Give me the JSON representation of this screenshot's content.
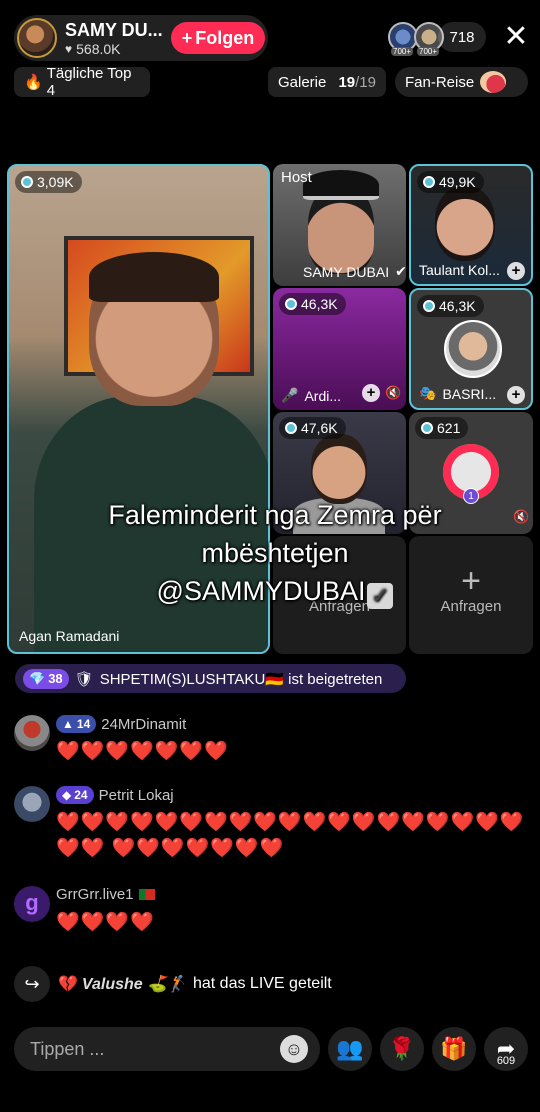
{
  "header": {
    "host_name": "SAMY DU...",
    "likes": "568.0K",
    "follow_label": "Folgen",
    "viewer_count": "718",
    "avatar_badge_1": "700+",
    "avatar_badge_2": "700+"
  },
  "chips": {
    "daily_top": "Tägliche Top 4",
    "gallery_label": "Galerie",
    "gallery_index": "19",
    "gallery_total": "/19",
    "fan_journey": "Fan-Reise"
  },
  "guests": {
    "main": {
      "viewers": "3,09K",
      "name": "Agan Ramadani"
    },
    "host": {
      "tag": "Host",
      "name": "SAMY DUBAI"
    },
    "taulant": {
      "viewers": "49,9K",
      "name": "Taulant Kol..."
    },
    "ardi": {
      "viewers": "46,3K",
      "name": "Ardi..."
    },
    "basri": {
      "viewers": "46,3K",
      "name": "BASRI..."
    },
    "gym": {
      "viewers": "47,6K"
    },
    "avatar621": {
      "viewers": "621",
      "level": "1"
    },
    "request1": {
      "label": "Anfragen"
    },
    "request2": {
      "label": "Anfragen"
    }
  },
  "caption": {
    "line1": "Faleminderit nga Zemra për",
    "line2": "mbështetjen",
    "line3": "@SAMMYDUBAI"
  },
  "join_banner": {
    "gem_level": "38",
    "text": "SHPETIM(S)LUSHTAKU🇩🇪 ist beigetreten"
  },
  "comments": [
    {
      "level": "14",
      "user": "24MrDinamit",
      "message": "❤️❤️❤️❤️❤️❤️❤️"
    },
    {
      "level": "24",
      "user": "Petrit Lokaj",
      "message": "❤️❤️❤️❤️❤️❤️❤️❤️❤️❤️❤️❤️❤️❤️❤️❤️❤️❤️❤️❤️❤️ ❤️❤️❤️❤️❤️❤️❤️"
    },
    {
      "user": "GrrGrr.live1",
      "message": "❤️❤️❤️❤️"
    }
  ],
  "share_event": {
    "user": "Valushe ⛳🏌",
    "text": "hat das LIVE geteilt"
  },
  "bottom_bar": {
    "input_placeholder": "Tippen ...",
    "share_count": "609"
  },
  "colors": {
    "follow": "#fe2c55",
    "highlight_border": "#5ec2d6",
    "heart_red": "#ff2a3a",
    "gem_purple": "#7b4de8"
  }
}
